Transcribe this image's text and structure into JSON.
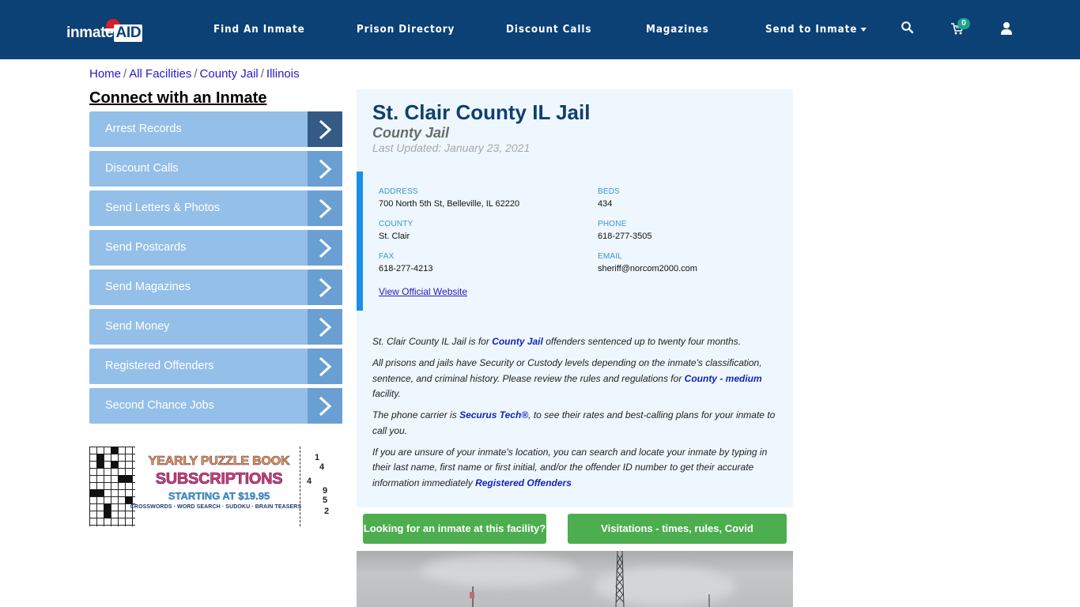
{
  "header": {
    "logo": {
      "text_main": "inmate",
      "text_accent": "AID"
    },
    "nav": [
      {
        "label": "Find An Inmate"
      },
      {
        "label": "Prison Directory"
      },
      {
        "label": "Discount Calls"
      },
      {
        "label": "Magazines"
      },
      {
        "label": "Send to Inmate",
        "has_dropdown": true
      }
    ],
    "icons": {
      "search": "search-icon",
      "cart": "cart-icon",
      "user": "user-icon"
    },
    "cart_count": "0"
  },
  "breadcrumb": [
    {
      "label": "Home"
    },
    {
      "label": "All Facilities"
    },
    {
      "label": "County Jail"
    },
    {
      "label": "Illinois"
    }
  ],
  "sidebar": {
    "title": "Connect with an Inmate",
    "items": [
      {
        "label": "Arrest Records",
        "active": true
      },
      {
        "label": "Discount Calls"
      },
      {
        "label": "Send Letters & Photos"
      },
      {
        "label": "Send Postcards"
      },
      {
        "label": "Send Magazines"
      },
      {
        "label": "Send Money"
      },
      {
        "label": "Registered Offenders"
      },
      {
        "label": "Second Chance Jobs"
      }
    ],
    "ad": {
      "line1": "YEARLY PUZZLE BOOK",
      "line2": "SUBSCRIPTIONS",
      "line3": "STARTING AT $19.95",
      "line4": "CROSSWORDS · WORD SEARCH · SUDOKU · BRAIN TEASERS",
      "sudoku_numbers": [
        "1",
        "4",
        "4",
        "9",
        "5",
        "2"
      ]
    }
  },
  "facility": {
    "name": "St. Clair County IL Jail",
    "type": "County Jail",
    "last_updated": "Last Updated: January 23, 2021",
    "fields": {
      "address": {
        "label": "ADDRESS",
        "value": "700 North 5th St, Belleville, IL 62220"
      },
      "beds": {
        "label": "BEDS",
        "value": "434"
      },
      "county": {
        "label": "COUNTY",
        "value": "St. Clair"
      },
      "phone": {
        "label": "PHONE",
        "value": "618-277-3505"
      },
      "fax": {
        "label": "FAX",
        "value": "618-277-4213"
      },
      "email": {
        "label": "EMAIL",
        "value": "sheriff@norcom2000.com"
      }
    },
    "website_link": "View Official Website",
    "description": {
      "p1_pre": "St. Clair County IL Jail is for ",
      "p1_link": "County Jail",
      "p1_post": " offenders sentenced up to twenty four months.",
      "p2_pre": "All prisons and jails have Security or Custody levels depending on the inmate's classification, sentence, and criminal history. Please review the rules and regulations for ",
      "p2_link": "County - medium",
      "p2_post": " facility.",
      "p3_pre": "The phone carrier is ",
      "p3_link": "Securus Tech®",
      "p3_post": ", to see their rates and best-calling plans for your inmate to call you.",
      "p4_pre": "If you are unsure of your inmate's location, you can search and locate your inmate by typing in their last name, first name or first initial, and/or the offender ID number to get their accurate information immediately ",
      "p4_link": "Registered Offenders"
    }
  },
  "actions": {
    "find_inmate": "Looking for an inmate at this facility?",
    "visitations": "Visitations - times, rules, Covid cancellations"
  },
  "colors": {
    "nav_bg": "#0b4175",
    "menu_item": "#94bfe8",
    "menu_arrow": "#6a9fd3",
    "menu_arrow_active": "#335b85",
    "panel_bg": "#eef7fd",
    "accent_bar": "#1a8fe8",
    "green_button": "#4cae4f",
    "title": "#0f3f6e"
  }
}
